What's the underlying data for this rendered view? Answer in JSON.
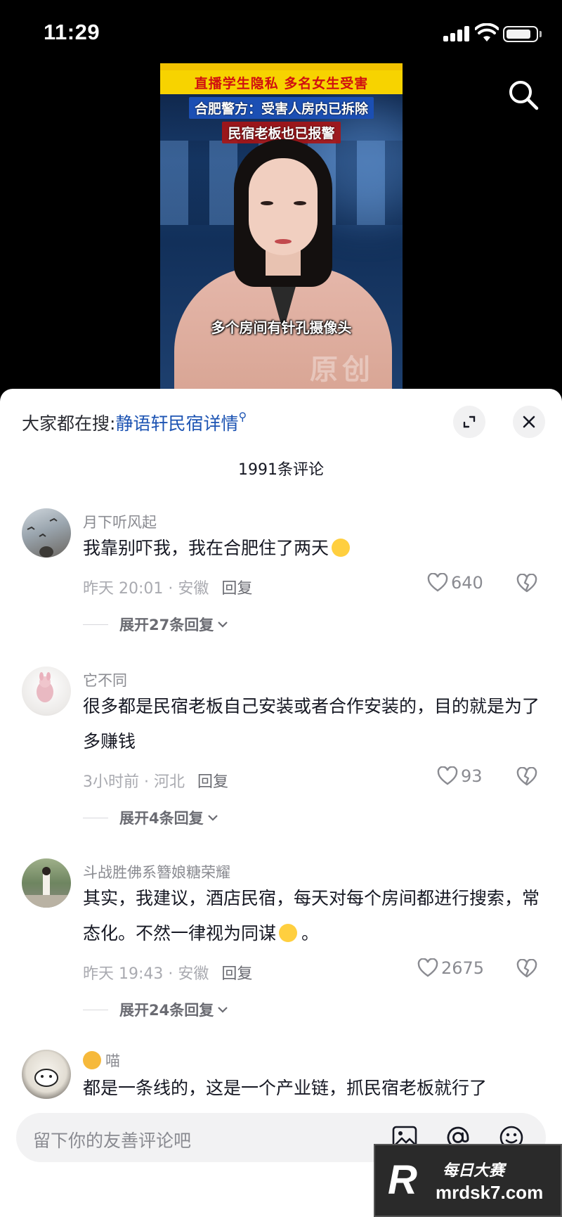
{
  "status_bar": {
    "time": "11:29"
  },
  "video": {
    "headline": "直播学生隐私 多名女生受害",
    "subtitle_lines": [
      "合肥警方：受害人房内已拆除",
      "民宿老板也已报警"
    ],
    "caption": "多个房间有针孔摄像头",
    "watermark": "原创"
  },
  "sheet": {
    "search_prefix": "大家都在搜:",
    "search_link": "静语轩民宿详情",
    "comment_count": "1991条评论",
    "comments": [
      {
        "user": "月下听风起",
        "text": "我靠别吓我，我在合肥住了两天",
        "time_location": "昨天 20:01 · 安徽",
        "reply": "回复",
        "likes": "640",
        "expand": "展开27条回复"
      },
      {
        "user": "它不同",
        "text": "很多都是民宿老板自己安装或者合作安装的，目的就是为了多赚钱",
        "time_location": "3小时前 · 河北",
        "reply": "回复",
        "likes": "93",
        "expand": "展开4条回复"
      },
      {
        "user": "斗战胜佛系簪娘糖荣耀",
        "text": "其实，我建议，酒店民宿，每天对每个房间都进行搜索，常态化。不然一律视为同谋",
        "text_end": "。",
        "time_location": "昨天 19:43 · 安徽",
        "reply": "回复",
        "likes": "2675",
        "expand": "展开24条回复"
      },
      {
        "user": "喵",
        "text": "都是一条线的，这是一个产业链，抓民宿老板就行了"
      }
    ],
    "input_placeholder": "留下你的友善评论吧"
  },
  "badge": {
    "title": "每日大赛",
    "url": "mrdsk7.com",
    "logo": "R"
  }
}
